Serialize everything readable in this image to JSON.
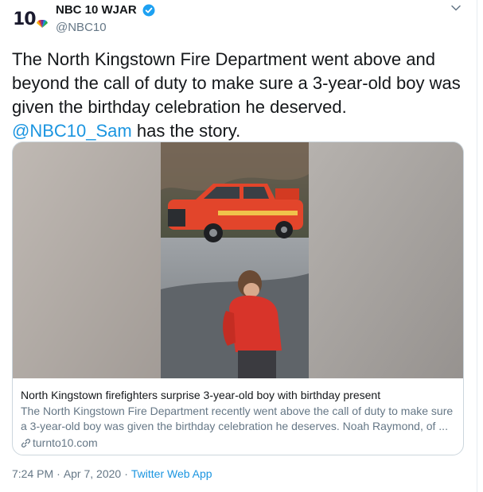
{
  "author": {
    "avatar_text": "10",
    "display_name": "NBC 10 WJAR",
    "handle": "@NBC10"
  },
  "tweet": {
    "text_before": "The North Kingstown Fire Department went above and beyond the call of duty to make sure a 3-year-old boy was given the birthday celebration he deserved. ",
    "mention": "@NBC10_Sam",
    "text_after": " has the story."
  },
  "card": {
    "title": "North Kingstown firefighters surprise 3-year-old boy with birthday present",
    "description": "The North Kingstown Fire Department recently went above the call of duty to make sure a 3-year-old boy was given the birthday celebration he deserves. Noah Raymond, of ...",
    "domain": "turnto10.com"
  },
  "meta": {
    "time": "7:24 PM",
    "separator": "·",
    "date": "Apr 7, 2020",
    "separator2": "·",
    "source": "Twitter Web App"
  },
  "colors": {
    "accent": "#1b95e0",
    "secondary_text": "#657786",
    "verified": "#1da1f2",
    "fire_truck": "#e2452b"
  },
  "icons": {
    "verified": "verified-badge-icon",
    "caret": "chevron-down-icon",
    "link": "link-icon"
  }
}
